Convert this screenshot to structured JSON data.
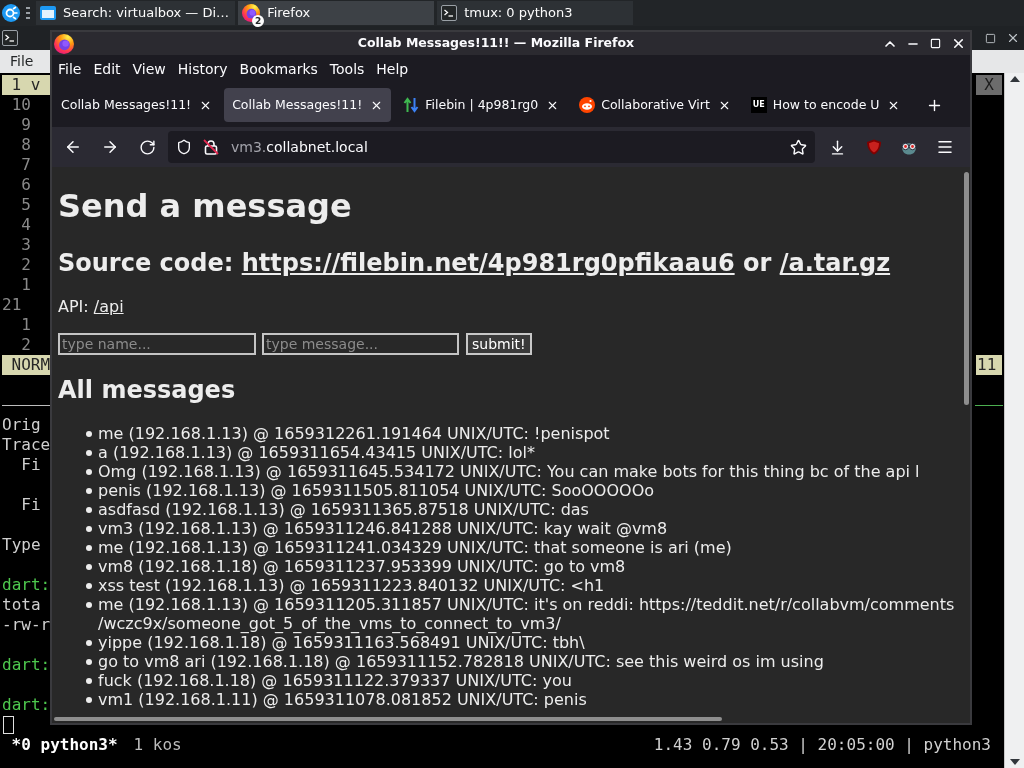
{
  "taskbar": {
    "tasks": [
      {
        "label": "Search: virtualbox — Di…",
        "selected": false
      },
      {
        "label": "Firefox",
        "badge": "2",
        "selected": true
      },
      {
        "label": "tmux: 0 python3",
        "selected": false
      }
    ]
  },
  "terminal": {
    "menu": [
      "File"
    ],
    "tabline": {
      "tab": "1 v",
      "close": "X"
    },
    "line_numbers": [
      {
        "text": "10",
        "kind": "relative"
      },
      {
        "text": "9",
        "kind": "relative"
      },
      {
        "text": "8",
        "kind": "relative"
      },
      {
        "text": "7",
        "kind": "relative"
      },
      {
        "text": "6",
        "kind": "relative"
      },
      {
        "text": "5",
        "kind": "relative"
      },
      {
        "text": "4",
        "kind": "relative"
      },
      {
        "text": "3",
        "kind": "relative"
      },
      {
        "text": "2",
        "kind": "relative"
      },
      {
        "text": "1",
        "kind": "relative"
      },
      {
        "text": "21",
        "kind": "current"
      },
      {
        "text": "1",
        "kind": "relative"
      },
      {
        "text": "2",
        "kind": "relative"
      }
    ],
    "mode": "NORM",
    "ruler": "11",
    "output": [
      {
        "kind": "text",
        "text": "Orig"
      },
      {
        "kind": "text",
        "text": "Trace"
      },
      {
        "kind": "indented",
        "text": "Fi"
      },
      {
        "kind": "blank"
      },
      {
        "kind": "indented",
        "text": "Fi"
      },
      {
        "kind": "blank"
      },
      {
        "kind": "text",
        "text": "Type"
      },
      {
        "kind": "blank"
      },
      {
        "kind": "prompt",
        "text": "dart:"
      },
      {
        "kind": "text",
        "text": "tota"
      },
      {
        "kind": "text",
        "text": "-rw-r"
      },
      {
        "kind": "blank"
      },
      {
        "kind": "prompt",
        "text": "dart:"
      },
      {
        "kind": "blank"
      },
      {
        "kind": "prompt",
        "text": "dart:"
      },
      {
        "kind": "cursor"
      }
    ],
    "status": {
      "current_window": "*0 python3*",
      "other_window": "1 kos",
      "right": "1.43 0.79 0.53 | 20:05:00 | python3"
    }
  },
  "firefox": {
    "title": "Collab Messages!11!! — Mozilla Firefox",
    "menu": [
      "File",
      "Edit",
      "View",
      "History",
      "Bookmarks",
      "Tools",
      "Help"
    ],
    "tabs": [
      {
        "label": "Collab Messages!11!",
        "selected": false
      },
      {
        "label": "Collab Messages!11!",
        "selected": true
      },
      {
        "label": "Filebin | 4p981rg0",
        "selected": false
      },
      {
        "label": "Collaborative Virt",
        "selected": false
      },
      {
        "label": "How to encode U",
        "selected": false,
        "favicon_text": "UE"
      }
    ],
    "url": {
      "subdomain": "vm3.",
      "domain": "collabnet.local"
    },
    "page": {
      "heading": "Send a message",
      "source": {
        "label": "Source code:",
        "link": "https://filebin.net/4p981rg0pfikaau6",
        "joiner": "or",
        "archive_link": "/a.tar.gz"
      },
      "api": {
        "label": "API:",
        "link": "/api"
      },
      "form": {
        "name_placeholder": "type name...",
        "message_placeholder": "type message...",
        "submit": "submit!"
      },
      "messages_heading": "All messages",
      "messages": [
        "me (192.168.1.13) @ 1659312261.191464 UNIX/UTC: !penispot",
        "a (192.168.1.13) @ 1659311654.43415 UNIX/UTC: lol*",
        "Omg (192.168.1.13) @ 1659311645.534172 UNIX/UTC: You can make bots for this thing bc of the api l",
        "penis (192.168.1.13) @ 1659311505.811054 UNIX/UTC: SooOOOOOo",
        "asdfasd (192.168.1.13) @ 1659311365.87518 UNIX/UTC: das",
        "vm3 (192.168.1.13) @ 1659311246.841288 UNIX/UTC: kay wait @vm8",
        "me (192.168.1.13) @ 1659311241.034329 UNIX/UTC: that someone is ari (me)",
        "vm8 (192.168.1.18) @ 1659311237.953399 UNIX/UTC: go to vm8",
        "xss test (192.168.1.13) @ 1659311223.840132 UNIX/UTC: <h1",
        "me (192.168.1.13) @ 1659311205.311857 UNIX/UTC: it's on reddi: https://teddit.net/r/collabvm/comments/wczc9x/someone_got_5_of_the_vms_to_connect_to_vm3/",
        "yippe (192.168.1.18) @ 1659311163.568491 UNIX/UTC: tbh\\",
        "go to vm8 ari (192.168.1.18) @ 1659311152.782818 UNIX/UTC: see this weird os im using",
        "fuck (192.168.1.18) @ 1659311122.379337 UNIX/UTC: you",
        "vm1 (192.168.1.11) @ 1659311078.081852 UNIX/UTC: penis"
      ]
    }
  }
}
